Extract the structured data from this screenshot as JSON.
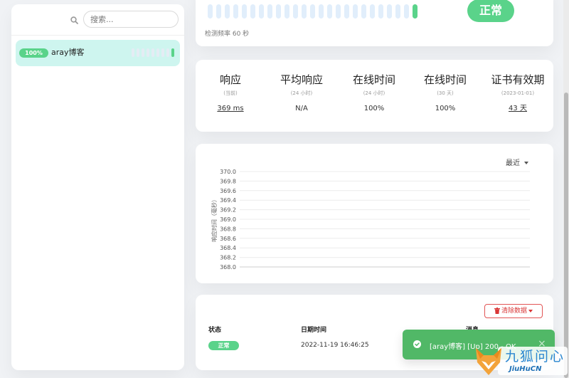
{
  "sidebar": {
    "search_placeholder": "搜索...",
    "monitors": [
      {
        "name": "aray博客",
        "uptime_badge": "100%",
        "beats": [
          "empty",
          "empty",
          "empty",
          "empty",
          "empty",
          "empty",
          "empty",
          "empty",
          "up"
        ]
      }
    ]
  },
  "header": {
    "beats": [
      "empty",
      "empty",
      "empty",
      "empty",
      "empty",
      "empty",
      "empty",
      "empty",
      "empty",
      "empty",
      "empty",
      "empty",
      "empty",
      "empty",
      "empty",
      "empty",
      "empty",
      "empty",
      "empty",
      "empty",
      "empty",
      "empty",
      "empty",
      "empty",
      "up"
    ],
    "status": "正常",
    "check_interval": "检测频率 60 秒"
  },
  "stats": [
    {
      "label": "响应",
      "sub": "(当前)",
      "value": "369 ms",
      "link": true
    },
    {
      "label": "平均响应",
      "sub": "(24 小时)",
      "value": "N/A",
      "link": false
    },
    {
      "label": "在线时间",
      "sub": "(24 小时)",
      "value": "100%",
      "link": false
    },
    {
      "label": "在线时间",
      "sub": "(30 天)",
      "value": "100%",
      "link": false
    },
    {
      "label": "证书有效期",
      "sub": "(2023-01-01)",
      "value": "43 天",
      "link": true
    }
  ],
  "chart_data": {
    "type": "line",
    "ylabel": "响应时间（毫秒）",
    "ylim": [
      368.0,
      370.0
    ],
    "y_ticks": [
      "370.0",
      "369.8",
      "369.6",
      "369.4",
      "369.2",
      "369.0",
      "368.8",
      "368.6",
      "368.4",
      "368.2",
      "368.0"
    ],
    "series": [],
    "grid": true,
    "period_select": "最近"
  },
  "events": {
    "clear_button": "清除数据",
    "columns": {
      "status": "状态",
      "datetime": "日期时间",
      "message": "消息"
    },
    "rows": [
      {
        "status": "正常",
        "datetime": "2022-11-19 16:46:25",
        "message": ""
      }
    ]
  },
  "toast": {
    "message": "[aray博客] [Up] 200 - OK",
    "close": "×",
    "color": "#51b867"
  },
  "watermark": {
    "text_cn": "九狐问心",
    "text_en": "JiuHuCN"
  },
  "colors": {
    "up": "#5ad38a",
    "beat_empty": "#e1eefb",
    "danger": "#d93737",
    "item_selected": "#cef5ef"
  }
}
